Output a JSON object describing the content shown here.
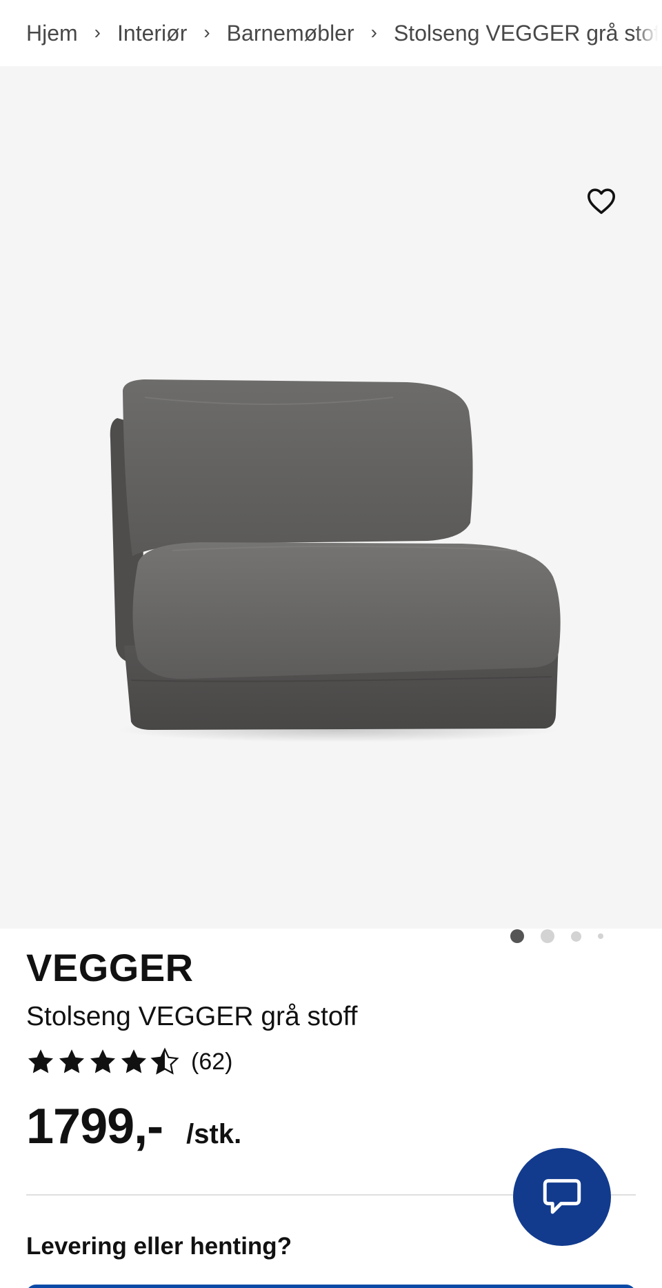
{
  "breadcrumb": {
    "items": [
      "Hjem",
      "Interiør",
      "Barnemøbler",
      "Stolseng VEGGER grå stoff"
    ],
    "separator": "›"
  },
  "gallery": {
    "favorite_icon": "heart-outline-icon",
    "image_alt": "grey fabric chair bed",
    "image_count": 4,
    "active_index": 0
  },
  "product": {
    "brand": "VEGGER",
    "subtitle": "Stolseng VEGGER grå stoff",
    "rating_value": 4.5,
    "rating_max": 5,
    "review_count": "(62)",
    "price": "1799,-",
    "unit": "/stk."
  },
  "chat": {
    "icon": "chat-bubble-icon"
  },
  "delivery": {
    "heading": "Levering eller henting?"
  },
  "colors": {
    "accent_blue": "#123b8e",
    "gallery_bg": "#f5f5f5",
    "text": "#111111",
    "dot_active": "#555555",
    "dot_inactive": "#d3d3d3"
  }
}
